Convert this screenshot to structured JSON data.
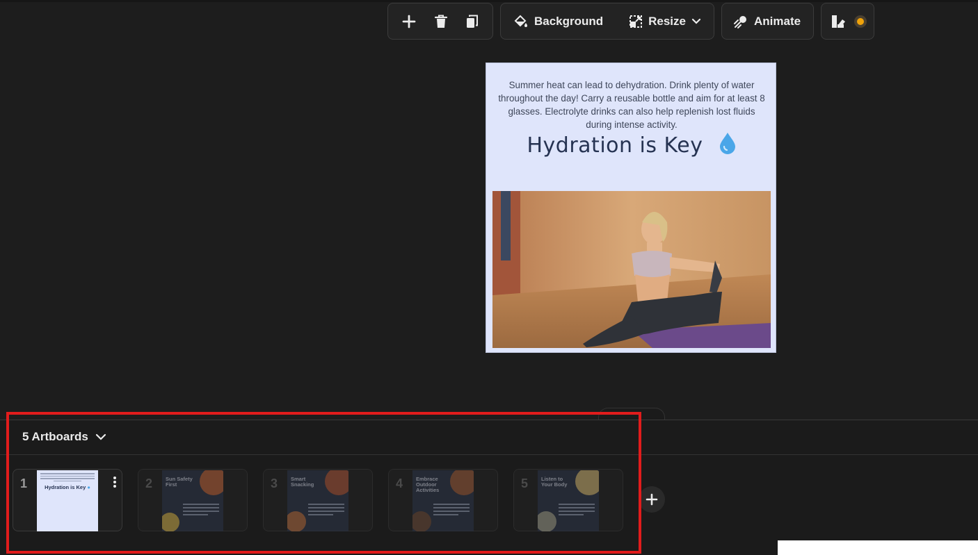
{
  "toolbar": {
    "add_label": "",
    "delete_label": "",
    "duplicate_label": "",
    "background_label": "Background",
    "resize_label": "Resize",
    "animate_label": "Animate"
  },
  "canvas": {
    "body_text": "Summer heat can lead to dehydration. Drink plenty of water throughout the day! Carry a reusable bottle and aim for at least 8 glasses. Electrolyte drinks can also help replenish lost fluids during intense activity.",
    "headline": "Hydration is Key",
    "headline_emoji": "droplet",
    "background_color": "#dfe5fb",
    "headline_color": "#263352"
  },
  "panel": {
    "artboards_count_label": "5 Artboards",
    "artboards": [
      {
        "number": "1",
        "title": "Hydration is Key",
        "active": true
      },
      {
        "number": "2",
        "title": "Sun Safety First",
        "active": false
      },
      {
        "number": "3",
        "title": "Smart Snacking",
        "active": false
      },
      {
        "number": "4",
        "title": "Embrace Outdoor Activities",
        "active": false
      },
      {
        "number": "5",
        "title": "Listen to Your Body",
        "active": false
      }
    ]
  },
  "colors": {
    "app_bg": "#1d1d1d",
    "highlight": "#e11c1c",
    "accent_orange": "#f0a30a"
  }
}
